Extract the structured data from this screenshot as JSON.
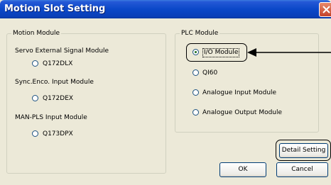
{
  "window": {
    "title": "Motion Slot Setting"
  },
  "motion_module": {
    "group_label": "Motion Module",
    "sections": [
      {
        "label": "Servo External Signal Module",
        "option": "Q172DLX"
      },
      {
        "label": "Sync.Enco. Input Module",
        "option": "Q172DEX"
      },
      {
        "label": "MAN-PLS Input Module",
        "option": "Q173DPX"
      }
    ]
  },
  "plc_module": {
    "group_label": "PLC Module",
    "options": [
      {
        "label": "I/O Module",
        "selected": true
      },
      {
        "label": "QI60",
        "selected": false
      },
      {
        "label": "Analogue Input Module",
        "selected": false
      },
      {
        "label": "Analogue Output Module",
        "selected": false
      }
    ]
  },
  "buttons": {
    "detail": "Detail Setting",
    "ok": "OK",
    "cancel": "Cancel"
  },
  "icons": {
    "close": "close-icon",
    "arrow": "arrow-icon"
  }
}
